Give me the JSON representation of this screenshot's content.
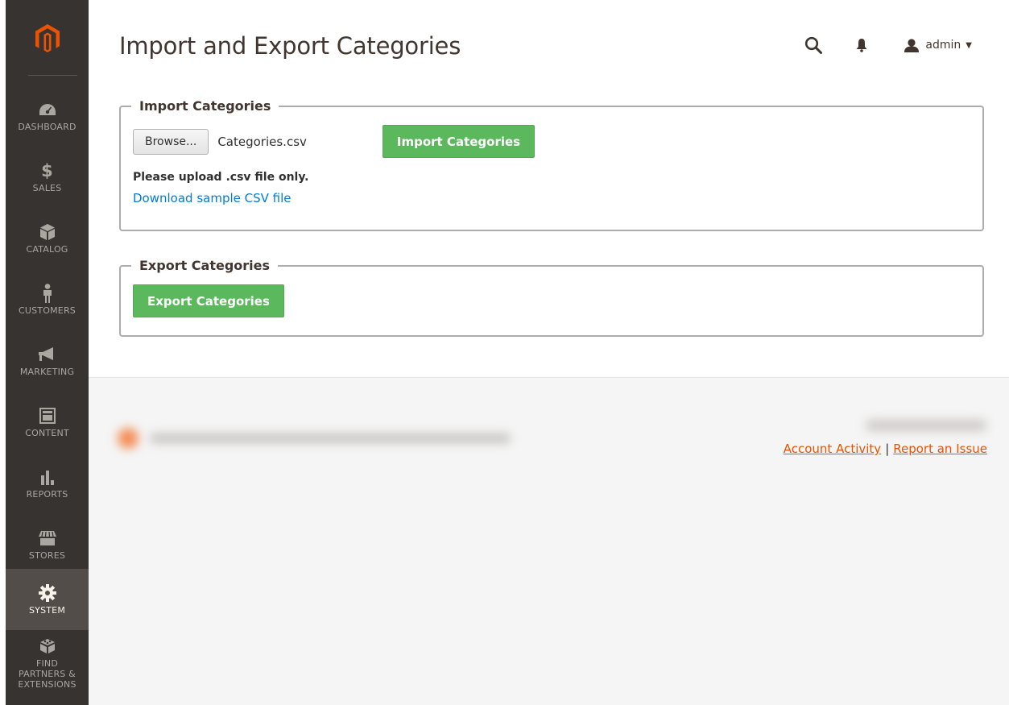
{
  "app": {
    "brand_color": "#eb5202",
    "logo_icon": "magento-logo"
  },
  "sidebar": {
    "items": [
      {
        "label": "DASHBOARD",
        "icon": "gauge-icon"
      },
      {
        "label": "SALES",
        "icon": "dollar-icon"
      },
      {
        "label": "CATALOG",
        "icon": "cube-icon"
      },
      {
        "label": "CUSTOMERS",
        "icon": "person-icon"
      },
      {
        "label": "MARKETING",
        "icon": "megaphone-icon"
      },
      {
        "label": "CONTENT",
        "icon": "layout-icon"
      },
      {
        "label": "REPORTS",
        "icon": "bar-chart-icon"
      },
      {
        "label": "STORES",
        "icon": "storefront-icon"
      },
      {
        "label": "SYSTEM",
        "icon": "gear-icon",
        "active": true
      },
      {
        "label": "FIND PARTNERS & EXTENSIONS",
        "icon": "blocks-icon"
      }
    ]
  },
  "header": {
    "title": "Import and Export Categories",
    "user_name": "admin"
  },
  "import_section": {
    "legend": "Import Categories",
    "browse_label": "Browse...",
    "file_name": "Categories.csv",
    "import_button": "Import Categories",
    "note": "Please upload .csv file only.",
    "sample_link": "Download sample CSV file"
  },
  "export_section": {
    "legend": "Export Categories",
    "export_button": "Export Categories"
  },
  "footer": {
    "account_activity": "Account Activity",
    "separator": "|",
    "report_issue": "Report an Issue"
  }
}
